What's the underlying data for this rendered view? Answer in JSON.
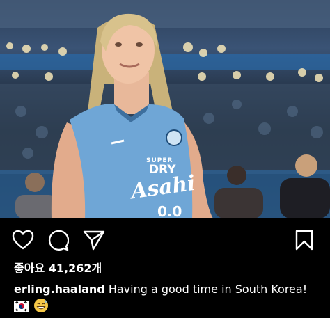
{
  "post": {
    "image_alt": "Player in sky blue sleeveless training jersey in a stadium",
    "jersey": {
      "sponsor_top": "SUPER",
      "sponsor_main": "DRY",
      "sponsor_brand": "Asahi",
      "sponsor_sub": "0.0"
    },
    "likes_label": "좋아요 41,262개",
    "username": "erling.haaland",
    "caption_text": " Having a good time in South Korea!"
  },
  "icons": {
    "like": "heart-icon",
    "comment": "comment-icon",
    "share": "send-icon",
    "save": "bookmark-icon",
    "flag": "south-korea-flag-icon",
    "emoji": "grinning-sweat-emoji-icon"
  },
  "colors": {
    "background": "#000000",
    "text": "#ffffff",
    "jersey": "#6fa6d6"
  }
}
